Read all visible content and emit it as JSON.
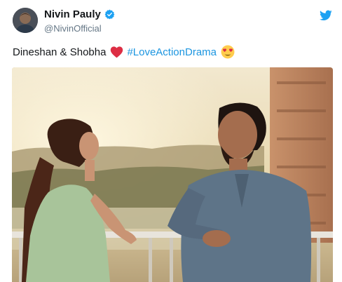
{
  "author": {
    "display_name": "Nivin Pauly",
    "handle": "@NivinOfficial",
    "verified": true
  },
  "icons": {
    "verified": "verified-badge-icon",
    "twitter": "twitter-bird-icon",
    "heart": "red-heart-emoji",
    "emoji": "heart-eyes-emoji"
  },
  "tweet": {
    "text": "Dineshan & Shobha",
    "hashtag": "#LoveActionDrama"
  },
  "colors": {
    "link": "#1b95e0",
    "twitter_blue": "#1da1f2",
    "heart_red": "#e0245e"
  }
}
